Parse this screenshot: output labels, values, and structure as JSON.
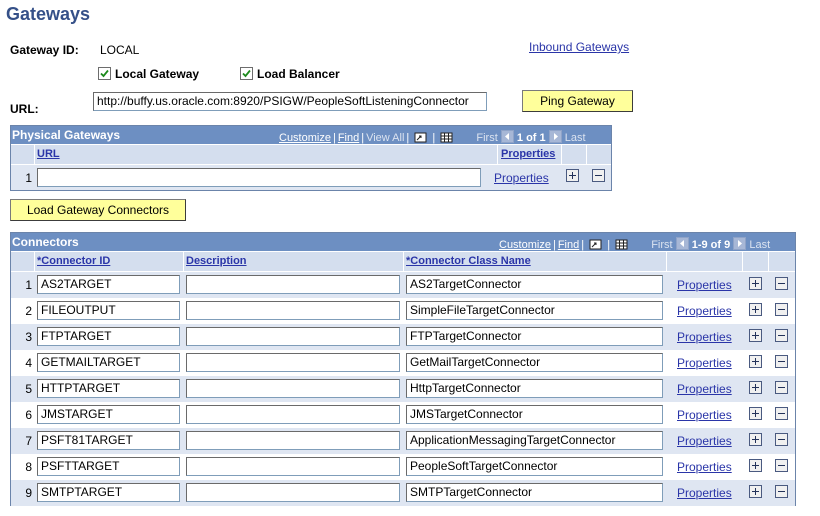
{
  "page": {
    "title": "Gateways"
  },
  "gateway": {
    "id_label": "Gateway ID:",
    "id_value": "LOCAL",
    "inbound_link": "Inbound Gateways",
    "local_gateway_label": "Local Gateway",
    "local_gateway_checked": true,
    "load_balancer_label": "Load Balancer",
    "load_balancer_checked": true,
    "url_label": "URL:",
    "url_value": "http://buffy.us.oracle.com:8920/PSIGW/PeopleSoftListeningConnector",
    "ping_button": "Ping Gateway"
  },
  "physical": {
    "title": "Physical Gateways",
    "nav": {
      "customize": "Customize",
      "find": "Find",
      "view_all": "View All",
      "first": "First",
      "range": "1 of 1",
      "last": "Last",
      "sep": "|"
    },
    "headers": {
      "url": "URL",
      "properties": "Properties"
    },
    "rows": [
      {
        "num": "1",
        "url": "",
        "properties": "Properties"
      }
    ]
  },
  "load_connectors_button": "Load Gateway Connectors",
  "connectors": {
    "title": "Connectors",
    "nav": {
      "customize": "Customize",
      "find": "Find",
      "first": "First",
      "range": "1-9 of 9",
      "last": "Last",
      "sep": "|"
    },
    "headers": {
      "id": "*Connector ID",
      "description": "Description",
      "class_name": "*Connector Class Name"
    },
    "rows": [
      {
        "num": "1",
        "id": "AS2TARGET",
        "description": "",
        "class_name": "AS2TargetConnector",
        "properties": "Properties"
      },
      {
        "num": "2",
        "id": "FILEOUTPUT",
        "description": "",
        "class_name": "SimpleFileTargetConnector",
        "properties": "Properties"
      },
      {
        "num": "3",
        "id": "FTPTARGET",
        "description": "",
        "class_name": "FTPTargetConnector",
        "properties": "Properties"
      },
      {
        "num": "4",
        "id": "GETMAILTARGET",
        "description": "",
        "class_name": "GetMailTargetConnector",
        "properties": "Properties"
      },
      {
        "num": "5",
        "id": "HTTPTARGET",
        "description": "",
        "class_name": "HttpTargetConnector",
        "properties": "Properties"
      },
      {
        "num": "6",
        "id": "JMSTARGET",
        "description": "",
        "class_name": "JMSTargetConnector",
        "properties": "Properties"
      },
      {
        "num": "7",
        "id": "PSFT81TARGET",
        "description": "",
        "class_name": "ApplicationMessagingTargetConnector",
        "properties": "Properties"
      },
      {
        "num": "8",
        "id": "PSFTTARGET",
        "description": "",
        "class_name": "PeopleSoftTargetConnector",
        "properties": "Properties"
      },
      {
        "num": "9",
        "id": "SMTPTARGET",
        "description": "",
        "class_name": "SMTPTargetConnector",
        "properties": "Properties"
      }
    ]
  },
  "colors": {
    "header_blue": "#6d8fc2",
    "title_blue": "#355088",
    "link_blue": "#2a35a8",
    "button_yellow": "#ffff9b",
    "row_alt": "#dfe6f2"
  }
}
